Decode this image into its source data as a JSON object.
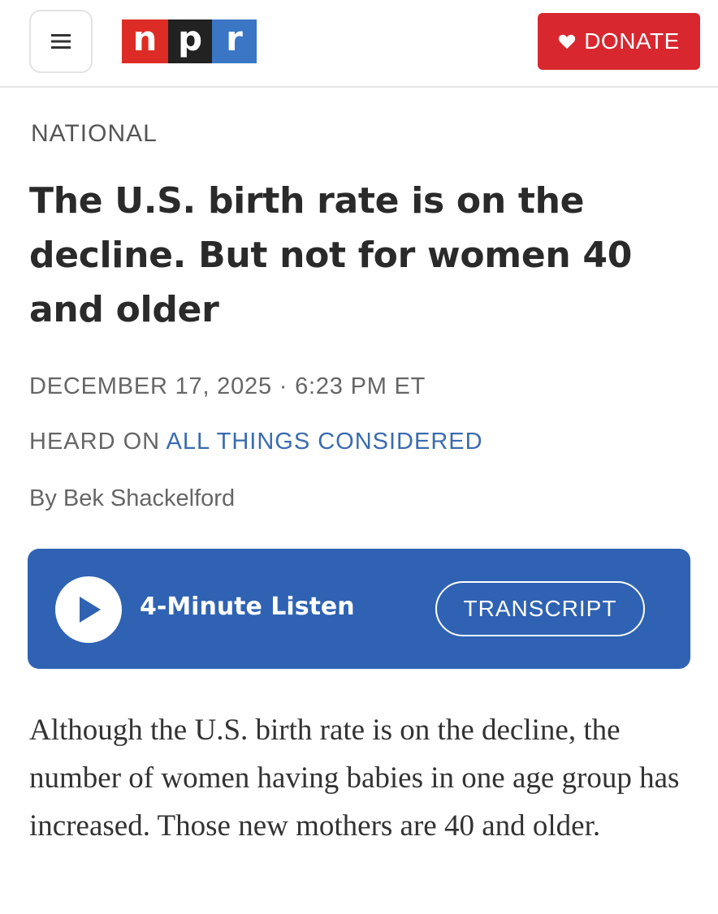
{
  "header": {
    "menu_icon": "hamburger-menu-icon",
    "logo": {
      "letters": [
        "n",
        "p",
        "r"
      ]
    },
    "donate": {
      "label": "DONATE",
      "icon": "heart-icon",
      "color": "#d8272f"
    }
  },
  "article": {
    "section": "NATIONAL",
    "headline": "The U.S. birth rate is on the decline. But not for women 40 and older",
    "dateline": "DECEMBER 17, 2025 · 6:23 PM ET",
    "heard_on_prefix": "HEARD ON",
    "program": "ALL THINGS CONSIDERED",
    "byline": "By Bek Shackelford",
    "body": "Although the U.S. birth rate is on the decline, the number of women having babies in one age group has increased. Those new mothers are 40 and older."
  },
  "player": {
    "play_icon": "play-icon",
    "listen_label": "4-Minute Listen",
    "transcript_label": "TRANSCRIPT",
    "color": "#2f62b3"
  },
  "colors": {
    "npr_red": "#dd2c25",
    "npr_black": "#222222",
    "npr_blue": "#3a76c4",
    "link_blue": "#3a6bb0"
  }
}
